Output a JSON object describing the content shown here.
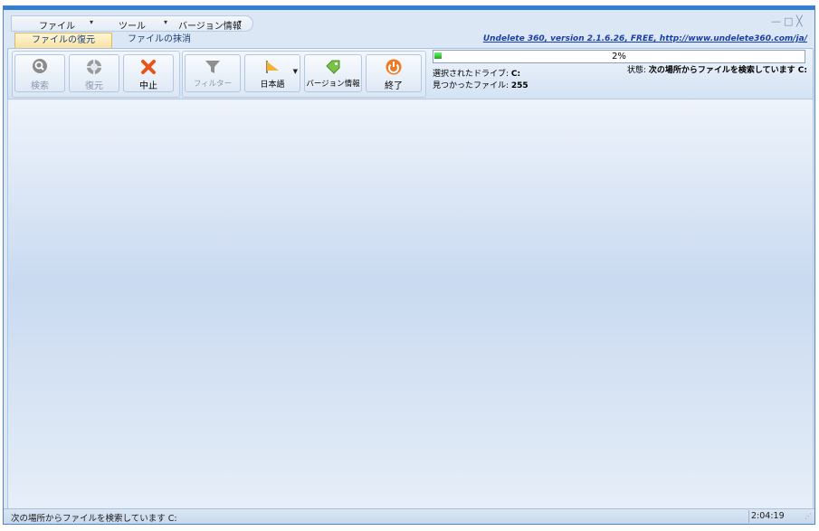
{
  "menu": {
    "items": [
      {
        "label": "ファイル"
      },
      {
        "label": "ツール"
      },
      {
        "label": "バージョン情報"
      }
    ]
  },
  "window_controls": {
    "minimize": "—",
    "maximize": "□",
    "close": "╳"
  },
  "tabs": [
    {
      "label": "ファイルの復元",
      "active": true
    },
    {
      "label": "ファイルの抹消",
      "active": false
    }
  ],
  "version_link": "Undelete 360, version 2.1.6.26, FREE, http://www.undelete360.com/ja/",
  "toolbar": {
    "search_label": "検索",
    "restore_label": "復元",
    "stop_label": "中止",
    "filter_label": "フィルター",
    "language_label": "日本語",
    "about_label": "バージョン情報",
    "exit_label": "終了"
  },
  "progress": {
    "value": 2,
    "text": "2%"
  },
  "info": {
    "drive_label": "選択されたドライブ: ",
    "drive_value": "C:",
    "found_label": "見つかったファイル: ",
    "found_value": "255",
    "status_label": "状態: ",
    "status_value": "次の場所からファイルを検索しています C:"
  },
  "statusbar": {
    "text": "次の場所からファイルを検索しています  C:",
    "time": "2:04:19"
  },
  "colors": {
    "accent": "#2f7fd4",
    "progress": "#1ca81c",
    "stop_icon": "#e8541a",
    "exit_icon": "#f07a22"
  }
}
